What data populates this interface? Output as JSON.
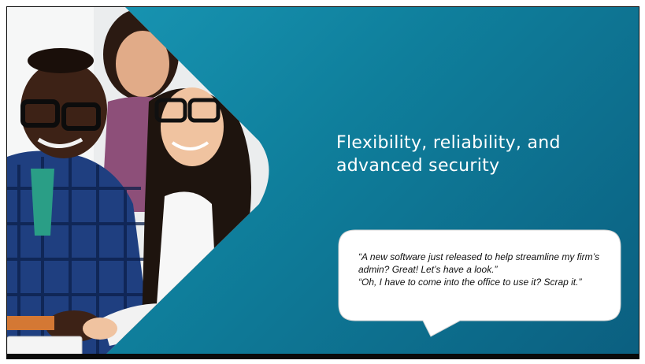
{
  "slide": {
    "headline": "Flexibility, reliability, and advanced security",
    "quote_lines": [
      "“A new software just released to help streamline my firm’s admin? Great! Let’s have a look.”",
      "“Oh, I have to come into the office to use it? Scrap it.”"
    ]
  },
  "colors": {
    "background_gradient": [
      "#1a9ab8",
      "#0b5f80"
    ],
    "text_light": "#ffffff",
    "bubble_fill": "#ffffff",
    "bubble_text": "#111111"
  }
}
